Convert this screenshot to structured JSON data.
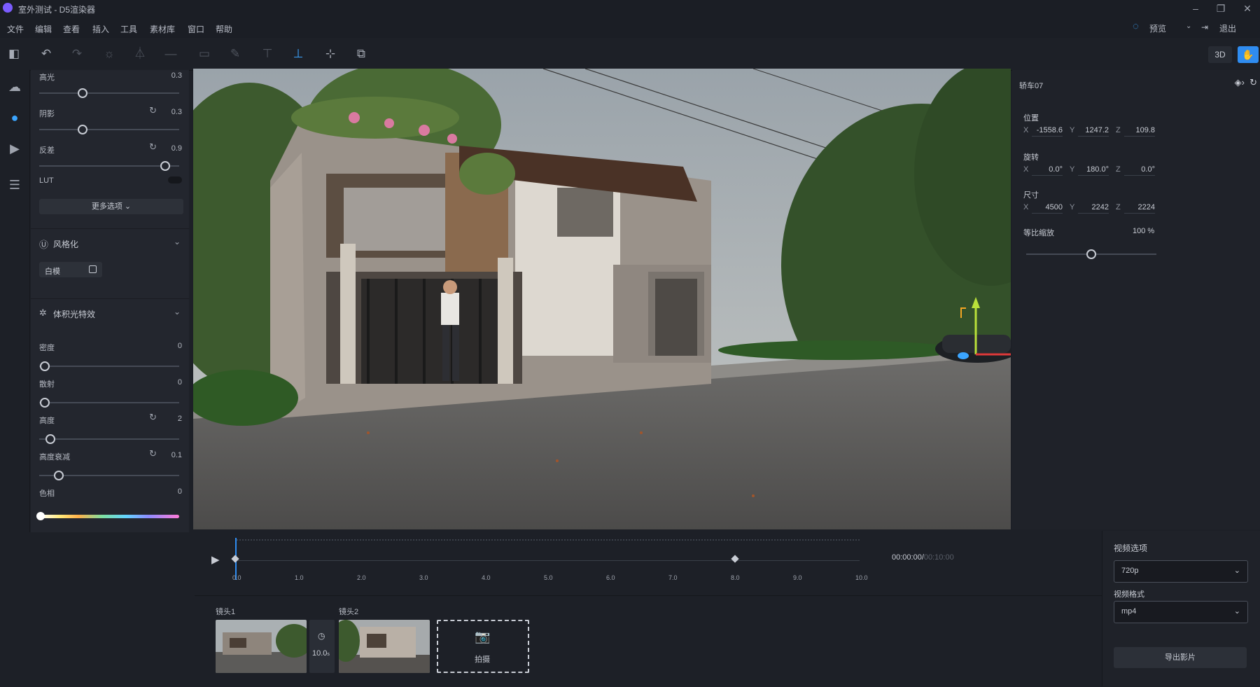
{
  "window": {
    "title": "室外测试 - D5渲染器",
    "controls": [
      "–",
      "❐",
      "✕"
    ]
  },
  "menubar": {
    "items": [
      "文件",
      "编辑",
      "查看",
      "插入",
      "工具",
      "素材库",
      "窗口",
      "帮助"
    ],
    "preview_label": "预览",
    "exit_label": "退出"
  },
  "toolbar": {
    "mode_3d": "3D"
  },
  "left_panel": {
    "highlight_label": "高光",
    "highlight_value": "0.3",
    "shadow_label": "阴影",
    "shadow_value": "0.3",
    "contrast_label": "反差",
    "contrast_value": "0.9",
    "lut_label": "LUT",
    "more_options": "更多选项",
    "stylize": {
      "title": "风格化",
      "white_model": "白模"
    },
    "volumetric": {
      "title": "体积光特效",
      "density_label": "密度",
      "density_value": "0",
      "scatter_label": "散射",
      "scatter_value": "0",
      "height_label": "高度",
      "height_value": "2",
      "height_falloff_label": "高度衰减",
      "height_falloff_value": "0.1",
      "hue_label": "色相",
      "hue_value": "0"
    }
  },
  "right_panel": {
    "object_name": "轿车07",
    "position_label": "位置",
    "position": {
      "x": "-1558.6",
      "y": "1247.2",
      "z": "109.8"
    },
    "rotation_label": "旋转",
    "rotation": {
      "x": "0.0°",
      "y": "180.0°",
      "z": "0.0°"
    },
    "size_label": "尺寸",
    "size": {
      "x": "4500",
      "y": "2242",
      "z": "2224"
    },
    "scale_label": "等比缩放",
    "scale_value": "100 %",
    "scale_fraction": 0.5
  },
  "timeline": {
    "ticks": [
      "0.0",
      "1.0",
      "2.0",
      "3.0",
      "4.0",
      "5.0",
      "6.0",
      "7.0",
      "8.0",
      "9.0",
      "10.0"
    ],
    "current_time": "00:00:00",
    "total_time": "00:10:00",
    "keyframe_at": 8.0
  },
  "shots": {
    "shot1_label": "镜头1",
    "shot2_label": "镜头2",
    "duration": "10.0",
    "capture_label": "拍摄"
  },
  "video_options": {
    "title": "视频选项",
    "resolution": "720p",
    "format_label": "视频格式",
    "format": "mp4",
    "export_label": "导出影片"
  },
  "colors": {
    "accent": "#2f8cf0",
    "panel": "#23262e",
    "background": "#1d2027"
  }
}
